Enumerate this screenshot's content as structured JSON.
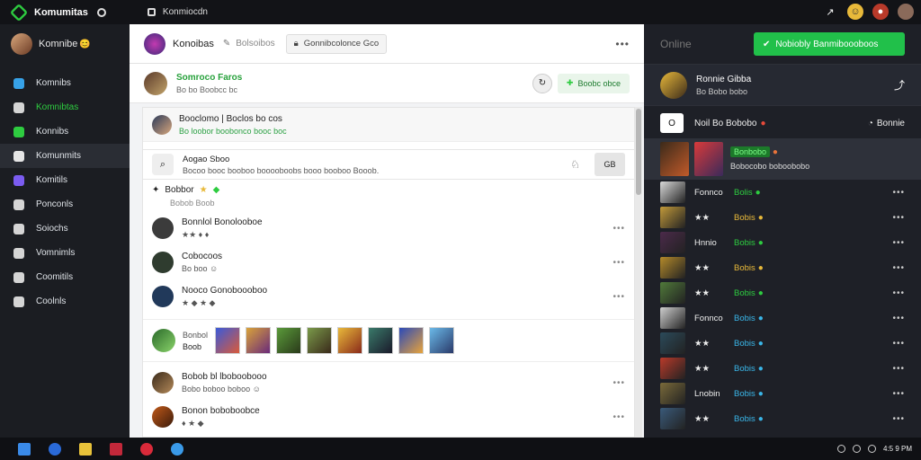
{
  "topbar": {
    "brand": "Komumitas",
    "app_title": "Konmiocdn",
    "icons": [
      "share-icon",
      "emoji-icon",
      "notification-icon",
      "user-avatar"
    ]
  },
  "sidebar": {
    "user_name": "Komnibe",
    "user_emoji": "😊",
    "items": [
      {
        "label": "Komnibs",
        "icon": "home-icon",
        "color": "#37a2e8",
        "active": false,
        "green": false
      },
      {
        "label": "Komnibtas",
        "icon": "feed-icon",
        "color": "#d5d5d5",
        "active": false,
        "green": true
      },
      {
        "label": "Konnibs",
        "icon": "chat-icon",
        "color": "#2ecc40",
        "active": false,
        "green": false
      },
      {
        "label": "Komunmits",
        "icon": "community-icon",
        "color": "#e6e6e6",
        "active": true,
        "green": false
      },
      {
        "label": "Komitils",
        "icon": "discord-icon",
        "color": "#7b5cf0",
        "active": false,
        "green": false
      },
      {
        "label": "Ponconls",
        "icon": "stats-icon",
        "color": "#d5d5d5",
        "active": false,
        "green": false
      },
      {
        "label": "Soiochs",
        "icon": "search-icon",
        "color": "#d5d5d5",
        "active": false,
        "green": false
      },
      {
        "label": "Vomnimls",
        "icon": "globe-icon",
        "color": "#d5d5d5",
        "active": false,
        "green": false
      },
      {
        "label": "Coomitils",
        "icon": "store-icon",
        "color": "#d5d5d5",
        "active": false,
        "green": false
      },
      {
        "label": "Coolnls",
        "icon": "list-icon",
        "color": "#d5d5d5",
        "active": false,
        "green": false
      }
    ]
  },
  "center": {
    "group_name": "Konoibas",
    "header_sub": "Bolsoibos",
    "search_text": "Gonnibcolonce Gco",
    "post": {
      "name": "Somroco Faros",
      "sub": "Bo bo Boobcc bc",
      "follow_label": "Boobc obce"
    },
    "thread": {
      "title": "Booclomo | Boclos bo cos",
      "sub": "Bo loobor boobonco booc boc"
    },
    "search_row": {
      "title": "Aogao Sboo",
      "sub": "Bocoo booc booboo booooboobs booo booboo Booob.",
      "button": "GB"
    },
    "section": {
      "label": "Bobbor",
      "sub": "Bobob Boob"
    },
    "comments": [
      {
        "name": "Bonnlol Bonolooboe",
        "meta": "★★ ♦ ♦",
        "avatar_color": "#3b3b3b"
      },
      {
        "name": "Cobocoos",
        "meta": "Bo boo ☺",
        "avatar_color": "#2f3c2f"
      },
      {
        "name": "Nooco Gonoboooboo",
        "meta": "★ ◆ ★ ◆",
        "avatar_color": "#21395a"
      }
    ],
    "gallery": {
      "label": "Bonbol",
      "sub": "Boob"
    },
    "last_comment": {
      "name": "Bobob bl lboboobooo",
      "meta": "Bobo boboo boboo ☺"
    },
    "reply": {
      "name": "Bonon boboboobce",
      "meta": "♦ ★ ◆"
    }
  },
  "right_panel": {
    "title": "Online",
    "invite_label": "Nobiobly Banmiboooboos",
    "profile": {
      "name": "Ronnie Gibba",
      "sub": "Bo Bobo bobo"
    },
    "list_header": {
      "left": "Noil Bo Bobobo",
      "right": "Bonnie"
    },
    "featured": {
      "badge": "Bonbobo",
      "sub": "Bobocobo boboobobo"
    },
    "friends": [
      {
        "name": "Fonnco",
        "status": "Bolis",
        "status_color": "#2ecc40",
        "img": "#d9d9d9"
      },
      {
        "name": "★★",
        "status": "Bobis",
        "status_color": "#e8b93a",
        "img": "#c29a3a"
      },
      {
        "name": "Hnnio",
        "status": "Bobis",
        "status_color": "#2ecc40",
        "img": "#4b2a4a"
      },
      {
        "name": "★★",
        "status": "Bobis",
        "status_color": "#e8b93a",
        "img": "#b48a2a"
      },
      {
        "name": "★★",
        "status": "Bobis",
        "status_color": "#2ecc40",
        "img": "#507a3a"
      },
      {
        "name": "Fonnco",
        "status": "Bobis",
        "status_color": "#3ab6e8",
        "img": "#cfcfcf"
      },
      {
        "name": "★★",
        "status": "Bobis",
        "status_color": "#3ab6e8",
        "img": "#2b4a5a"
      },
      {
        "name": "★★",
        "status": "Bobis",
        "status_color": "#3ab6e8",
        "img": "#b93a2a"
      },
      {
        "name": "Lnobin",
        "status": "Bobis",
        "status_color": "#3ab6e8",
        "img": "#7a6a3a"
      },
      {
        "name": "★★",
        "status": "Bobis",
        "status_color": "#3ab6e8",
        "img": "#3a5a7a"
      }
    ]
  },
  "taskbar": {
    "apps": [
      "windows-icon",
      "browser-icon",
      "folder-icon",
      "media-icon",
      "opera-icon",
      "globe-icon"
    ],
    "tray_time": "4:5 9 PM"
  },
  "colors": {
    "accent_green": "#21c04a",
    "dark_bg": "#14161b"
  }
}
